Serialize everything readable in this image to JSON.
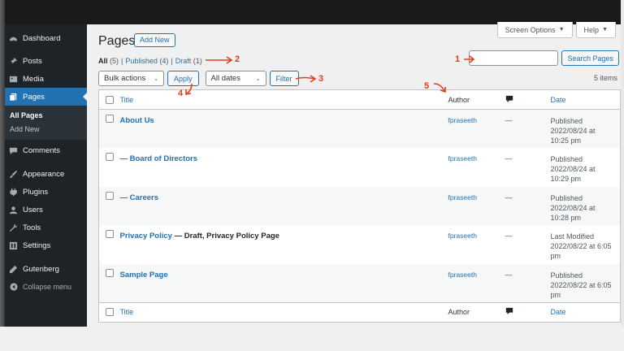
{
  "sidebar": {
    "items": [
      {
        "label": "Dashboard",
        "icon": "dashboard-icon"
      },
      {
        "label": "Posts",
        "icon": "pin-icon"
      },
      {
        "label": "Media",
        "icon": "media-icon"
      },
      {
        "label": "Pages",
        "icon": "pages-icon",
        "active": true
      },
      {
        "label": "Comments",
        "icon": "comments-icon"
      },
      {
        "label": "Appearance",
        "icon": "brush-icon"
      },
      {
        "label": "Plugins",
        "icon": "plug-icon"
      },
      {
        "label": "Users",
        "icon": "user-icon"
      },
      {
        "label": "Tools",
        "icon": "wrench-icon"
      },
      {
        "label": "Settings",
        "icon": "settings-icon"
      },
      {
        "label": "Gutenberg",
        "icon": "pencil-icon"
      }
    ],
    "submenu": [
      "All Pages",
      "Add New"
    ],
    "collapse": "Collapse menu"
  },
  "header": {
    "screen_options": "Screen Options",
    "help": "Help",
    "title": "Pages",
    "add_new": "Add New"
  },
  "filters": {
    "all": "All",
    "all_count": "(5)",
    "published": "Published",
    "published_count": "(4)",
    "draft": "Draft",
    "draft_count": "(1)",
    "sep": "|"
  },
  "search": {
    "button": "Search Pages",
    "value": ""
  },
  "tablenav": {
    "bulk_actions": "Bulk actions",
    "apply": "Apply",
    "dates": "All dates",
    "filter": "Filter",
    "items": "5 items"
  },
  "table": {
    "columns": {
      "title": "Title",
      "author": "Author",
      "date": "Date"
    },
    "rows": [
      {
        "title": "About Us",
        "state": "",
        "author": "fpraseeth",
        "comments": "—",
        "date": [
          "Published",
          "2022/08/24 at",
          "10:25 pm"
        ]
      },
      {
        "title": "— Board of Directors",
        "state": "",
        "author": "fpraseeth",
        "comments": "—",
        "date": [
          "Published",
          "2022/08/24 at",
          "10:29 pm"
        ]
      },
      {
        "title": "— Careers",
        "state": "",
        "author": "fpraseeth",
        "comments": "—",
        "date": [
          "Published",
          "2022/08/24 at",
          "10:28 pm"
        ]
      },
      {
        "title": "Privacy Policy",
        "state": " — Draft, Privacy Policy Page",
        "author": "fpraseeth",
        "comments": "—",
        "date": [
          "Last Modified",
          "2022/08/22 at 6:05",
          "pm"
        ]
      },
      {
        "title": "Sample Page",
        "state": "",
        "author": "fpraseeth",
        "comments": "—",
        "date": [
          "Published",
          "2022/08/22 at 6:05",
          "pm"
        ]
      }
    ]
  },
  "annotations": [
    "1",
    "2",
    "3",
    "4",
    "5"
  ],
  "colors": {
    "accent": "#2271b1",
    "sidebar": "#1d2327",
    "annotation": "#e2401c"
  }
}
